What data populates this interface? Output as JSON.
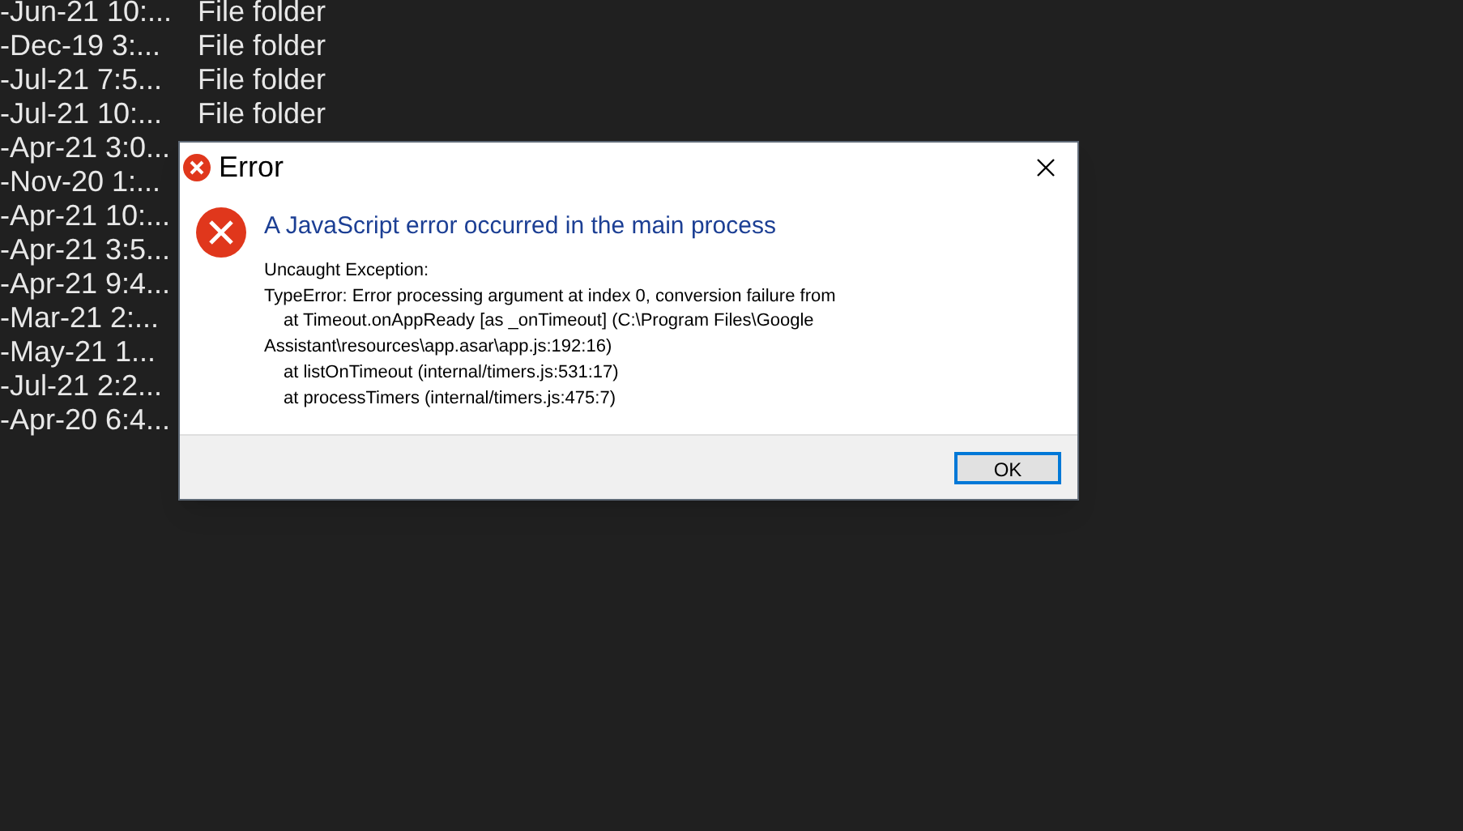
{
  "file_list": [
    {
      "date": "-Jun-21 10:...",
      "type": "File folder"
    },
    {
      "date": "-Dec-19 3:...",
      "type": "File folder"
    },
    {
      "date": "-Jul-21 7:5...",
      "type": "File folder"
    },
    {
      "date": "-Jul-21 10:...",
      "type": "File folder"
    },
    {
      "date": "-Apr-21 3:0..."
    },
    {
      "date": "-Nov-20 1:..."
    },
    {
      "date": "-Apr-21 10:..."
    },
    {
      "date": "-Apr-21 3:5..."
    },
    {
      "date": "-Apr-21 9:4..."
    },
    {
      "date": "-Mar-21 2:..."
    },
    {
      "date": "-May-21 1..."
    },
    {
      "date": "-Jul-21 2:2..."
    },
    {
      "date": "-Apr-20 6:4..."
    }
  ],
  "dialog": {
    "title": "Error",
    "heading": "A JavaScript error occurred in the main process",
    "message_lines": [
      {
        "text": "Uncaught Exception:",
        "indent": false
      },
      {
        "text": "TypeError: Error processing argument at index 0, conversion failure from",
        "indent": false
      },
      {
        "text": "at Timeout.onAppReady [as _onTimeout] (C:\\Program Files\\Google",
        "indent": true
      },
      {
        "text": "Assistant\\resources\\app.asar\\app.js:192:16)",
        "indent": false
      },
      {
        "text": "at listOnTimeout (internal/timers.js:531:17)",
        "indent": true
      },
      {
        "text": "at processTimers (internal/timers.js:475:7)",
        "indent": true
      }
    ],
    "buttons": [
      "OK"
    ]
  }
}
